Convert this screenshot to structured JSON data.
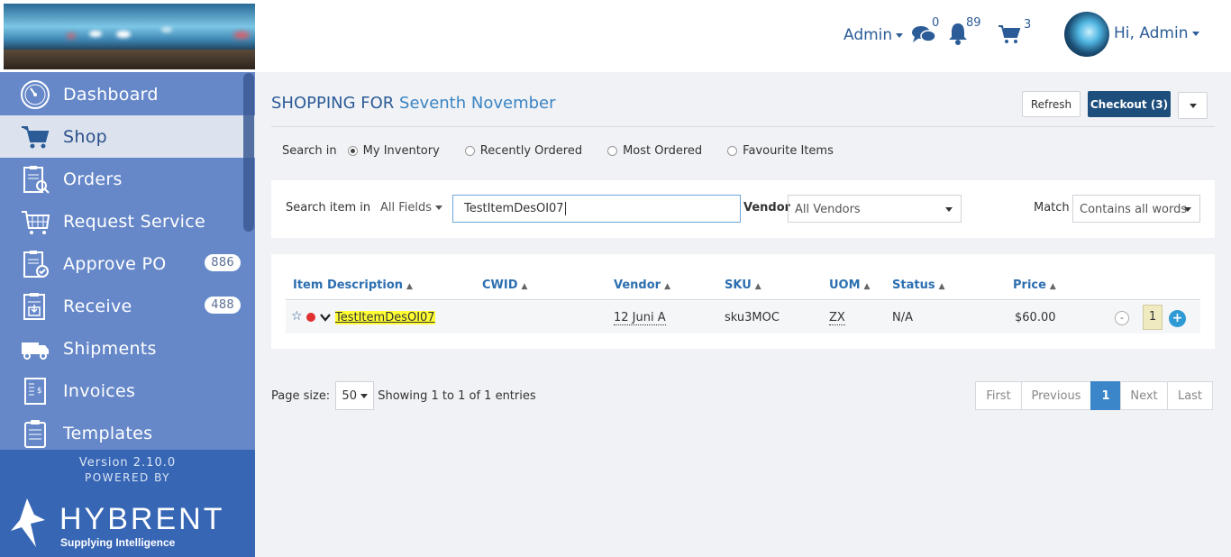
{
  "sidebar": {
    "items": [
      {
        "label": "Dashboard",
        "icon": "dashboard-icon"
      },
      {
        "label": "Shop",
        "icon": "cart-icon",
        "active": true
      },
      {
        "label": "Orders",
        "icon": "orders-icon"
      },
      {
        "label": "Request Service",
        "icon": "request-service-icon"
      },
      {
        "label": "Approve PO",
        "icon": "approve-po-icon",
        "badge": "886"
      },
      {
        "label": "Receive",
        "icon": "receive-icon",
        "badge": "488"
      },
      {
        "label": "Shipments",
        "icon": "truck-icon"
      },
      {
        "label": "Invoices",
        "icon": "invoice-icon"
      },
      {
        "label": "Templates",
        "icon": "templates-icon"
      }
    ],
    "version": "Version 2.10.0",
    "powered_by": "POWERED BY",
    "logo_text": "HYBRENT",
    "logo_sub": "Supplying Intelligence"
  },
  "header": {
    "admin_label": "Admin",
    "messages_count": "0",
    "notifications_count": "89",
    "cart_count": "3",
    "greeting": "Hi, Admin"
  },
  "main": {
    "title_prefix": "SHOPPING FOR",
    "title_name": "Seventh November",
    "refresh_label": "Refresh",
    "checkout_label": "Checkout (3)",
    "search_in_label": "Search in",
    "search_options": [
      "My Inventory",
      "Recently Ordered",
      "Most Ordered",
      "Favourite Items"
    ],
    "selected_option": "My Inventory",
    "search_item_label": "Search item in",
    "fields_dropdown": "All Fields",
    "search_value": "TestItemDesOI07",
    "vendor_label": "Vendor",
    "vendor_value": "All Vendors",
    "match_label": "Match",
    "match_value": "Contains all words"
  },
  "table": {
    "columns": [
      "Item Description",
      "CWID",
      "Vendor",
      "SKU",
      "UOM",
      "Status",
      "Price"
    ],
    "rows": [
      {
        "description": "TestItemDesOI07",
        "cwid": "",
        "vendor": "12 Juni A",
        "sku": "sku3MOC",
        "uom": "ZX",
        "status": "N/A",
        "price": "$60.00",
        "qty": "1"
      }
    ]
  },
  "pagination": {
    "page_size_label": "Page size:",
    "page_size": "50",
    "summary": "Showing 1 to 1 of 1 entries",
    "buttons": [
      "First",
      "Previous",
      "1",
      "Next",
      "Last"
    ],
    "current": "1"
  },
  "colors": {
    "sidebar": "#6688c9",
    "sidebar_footer": "#3766b5",
    "accent": "#2c5c98",
    "checkout": "#1e4e7c",
    "active_page": "#3a86c8"
  }
}
